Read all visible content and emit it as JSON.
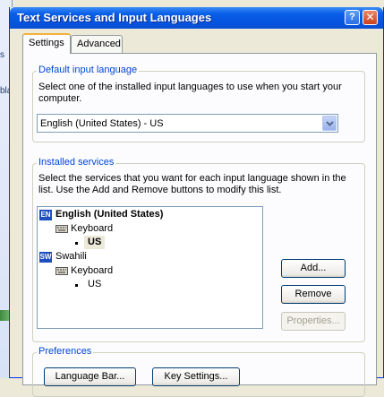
{
  "background_window": {
    "fragments": [
      "s",
      "blac"
    ]
  },
  "window": {
    "title": "Text Services and Input Languages",
    "help_glyph": "?",
    "close_glyph": "✕"
  },
  "tabs": [
    {
      "label": "Settings",
      "active": true
    },
    {
      "label": "Advanced",
      "active": false
    }
  ],
  "default_input_language": {
    "label": "Default input language",
    "description": "Select one of the installed input languages to use when you start your computer.",
    "selected": "English (United States) - US"
  },
  "installed_services": {
    "label": "Installed services",
    "description": "Select the services that you want for each input language shown in the list. Use the Add and Remove buttons to modify this list.",
    "tree": [
      {
        "badge": "EN",
        "name": "English (United States)",
        "category": "Keyboard",
        "layout": "US"
      },
      {
        "badge": "SW",
        "name": "Swahili",
        "category": "Keyboard",
        "layout": "US"
      }
    ],
    "buttons": {
      "add": "Add...",
      "remove": "Remove",
      "properties": "Properties..."
    }
  },
  "preferences": {
    "label": "Preferences",
    "buttons": {
      "language_bar": "Language Bar...",
      "key_settings": "Key Settings..."
    }
  },
  "colors": {
    "title_bar": "#0554e0",
    "group_label": "#0046d5",
    "dialog_face": "#ece9d8"
  }
}
